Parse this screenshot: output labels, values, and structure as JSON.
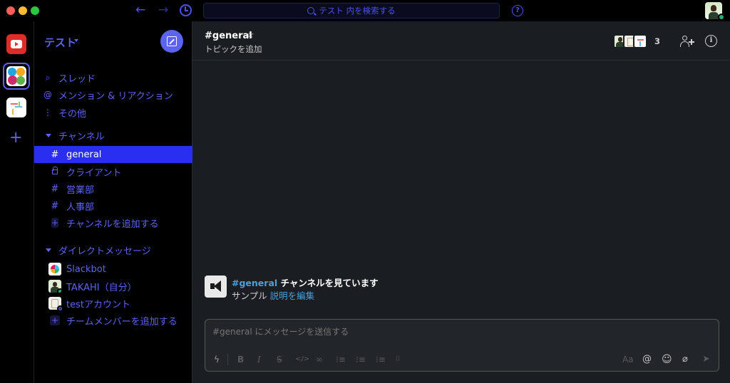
{
  "titlebar": {
    "search_placeholder": "テスト 内を検索する",
    "back_icon": "arrow-left-icon",
    "forward_icon": "arrow-right-icon",
    "history_icon": "clock-icon",
    "help_icon": "question-icon",
    "help_glyph": "?"
  },
  "workspace": {
    "name": "テスト"
  },
  "rail": {
    "add_glyph": "+"
  },
  "sidebar": {
    "nav": [
      {
        "label": "スレッド",
        "glyph": "q"
      },
      {
        "label": "メンション & リアクション",
        "glyph": "@"
      },
      {
        "label": "その他",
        "glyph": "⋮"
      }
    ],
    "channels_header": "チャンネル",
    "channels": [
      {
        "name": "general",
        "glyph": "#"
      },
      {
        "name": "クライアント",
        "glyph": ""
      },
      {
        "name": "営業部",
        "glyph": "#"
      },
      {
        "name": "人事部",
        "glyph": "#"
      }
    ],
    "add_channel": "チャンネルを追加する",
    "dm_header": "ダイレクトメッセージ",
    "dms": [
      {
        "name": "Slackbot"
      },
      {
        "name": "TAKAHI（自分）"
      },
      {
        "name": "testアカウント"
      }
    ],
    "add_member": "チームメンバーを追加する",
    "plus_glyph": "+"
  },
  "channel": {
    "title": "#general",
    "star_glyph": "☆",
    "topic": "トピックを追加",
    "member_count": "3",
    "info_glyph": "i"
  },
  "intro": {
    "channel_link": "#general",
    "title_rest": " チャンネルを見ています",
    "description": "サンプル",
    "edit_link": "説明を編集"
  },
  "composer": {
    "placeholder": "#general にメッセージを送信する",
    "toolbar": {
      "bolt": "ϟ",
      "bold": "B",
      "italic": "I",
      "strike": "S",
      "code": "</>",
      "link": "∞",
      "ordered_list": "⁝≡",
      "bullet_list": "⁝≡",
      "quote": "⁝≡",
      "code_block": "⌷",
      "format": "Aa",
      "mention": "@",
      "emoji": "☺",
      "attach": "⌀",
      "send": "➤"
    }
  },
  "colors": {
    "accent": "#5b63f0",
    "active_channel": "#2a2ef0",
    "link": "#4ba0d8",
    "presence": "#2bac76"
  }
}
